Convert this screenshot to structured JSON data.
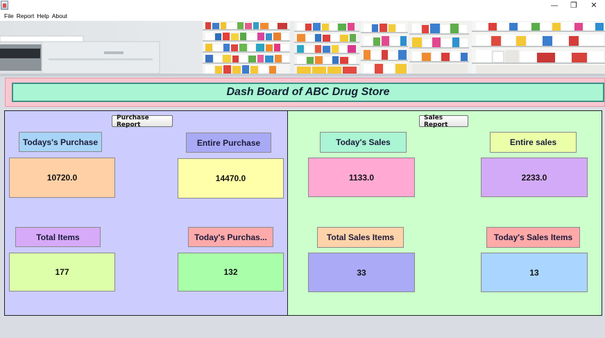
{
  "menu": [
    "File",
    "Report",
    "Help",
    "About"
  ],
  "window_controls": {
    "minimize": "—",
    "maximize": "❐",
    "close": "✕"
  },
  "header": {
    "title": "Dash Board of ABC Drug Store"
  },
  "purchase": {
    "button": "Purchase Report",
    "todays_purchase_label": "Todays's Purchase",
    "todays_purchase_value": "10720.0",
    "entire_purchase_label": "Entire Purchase",
    "entire_purchase_value": "14470.0",
    "total_items_label": "Total Items",
    "total_items_value": "177",
    "todays_purchase_items_label": "Today's Purchas...",
    "todays_purchase_items_value": "132"
  },
  "sales": {
    "button": "Sales Report",
    "todays_sales_label": "Today's Sales",
    "todays_sales_value": "1133.0",
    "entire_sales_label": "Entire sales",
    "entire_sales_value": "2233.0",
    "total_sales_items_label": "Total Sales Items",
    "total_sales_items_value": "33",
    "todays_sales_items_label": "Today's Sales Items",
    "todays_sales_items_value": "13"
  },
  "colors": {
    "purchase_panel": "#ccccff",
    "sales_panel": "#ccffcc",
    "header_band": "#f9c6d0",
    "title_box": "#aaf5d3"
  }
}
